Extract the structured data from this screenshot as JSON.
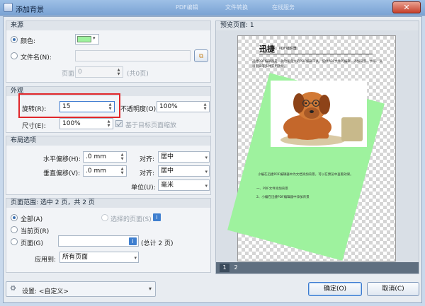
{
  "window": {
    "title": "添加背景",
    "bg_tabs": [
      "PDF编辑",
      "文件转换",
      "在线服务"
    ]
  },
  "source": {
    "group_title": "来源",
    "color_label": "颜色:",
    "color_value": "#9ef29e",
    "file_label": "文件名(N):",
    "file_value": "",
    "page_label": "页面:",
    "page_value": "0",
    "page_total": "(共0页)"
  },
  "appearance": {
    "group_title": "外观",
    "rotate_label": "旋转(R):",
    "rotate_value": "15",
    "opacity_label": "不透明度(O):",
    "opacity_value": "100%",
    "scale_label": "尺寸(E):",
    "scale_value": "100%",
    "scale_relative_label": "基于目标页面缩放"
  },
  "layout": {
    "group_title": "布局选项",
    "h_offset_label": "水平偏移(H):",
    "h_offset_value": ".0 mm",
    "v_offset_label": "垂直偏移(V):",
    "v_offset_value": ".0 mm",
    "align_label": "对齐:",
    "h_align_value": "居中",
    "v_align_value": "居中",
    "unit_label": "单位(U):",
    "unit_value": "毫米"
  },
  "page_range": {
    "group_title": "页面范围: 选中 2 页，共 2 页",
    "all_label": "全部(A)",
    "selected_label": "选择的页面(S)",
    "current_label": "当前页(R)",
    "pages_label": "页面(G)",
    "pages_value": "",
    "pages_total": "(总计 2 页)",
    "apply_label": "应用到:",
    "apply_value": "所有页面"
  },
  "preview": {
    "title": "预览页面: 1",
    "pages": [
      "1",
      "2"
    ],
    "doc_title": "迅捷",
    "doc_subtitle": "PDF编辑器",
    "doc_body": "迅捷PDF编辑器是一款功能强大的PDF编辑工具，提供PDF文件的编辑、添加背景、水印、页眉页脚等多种实用功能。",
    "doc_caption": "小编在迅捷PDF编辑器中为文档添加背景，可以在预览中查看效果。",
    "doc_list": [
      "一、PDF文件添加背景",
      "2、小编在迅捷PDF编辑器中添加背景"
    ],
    "bg_color": "#9ef29e",
    "bg_rotation": 15
  },
  "footer": {
    "settings_label": "设置: <自定义>",
    "ok_label": "确定(O)",
    "cancel_label": "取消(C)"
  },
  "colors": {
    "accent": "#3a6fb0",
    "highlight": "#e0262a"
  }
}
